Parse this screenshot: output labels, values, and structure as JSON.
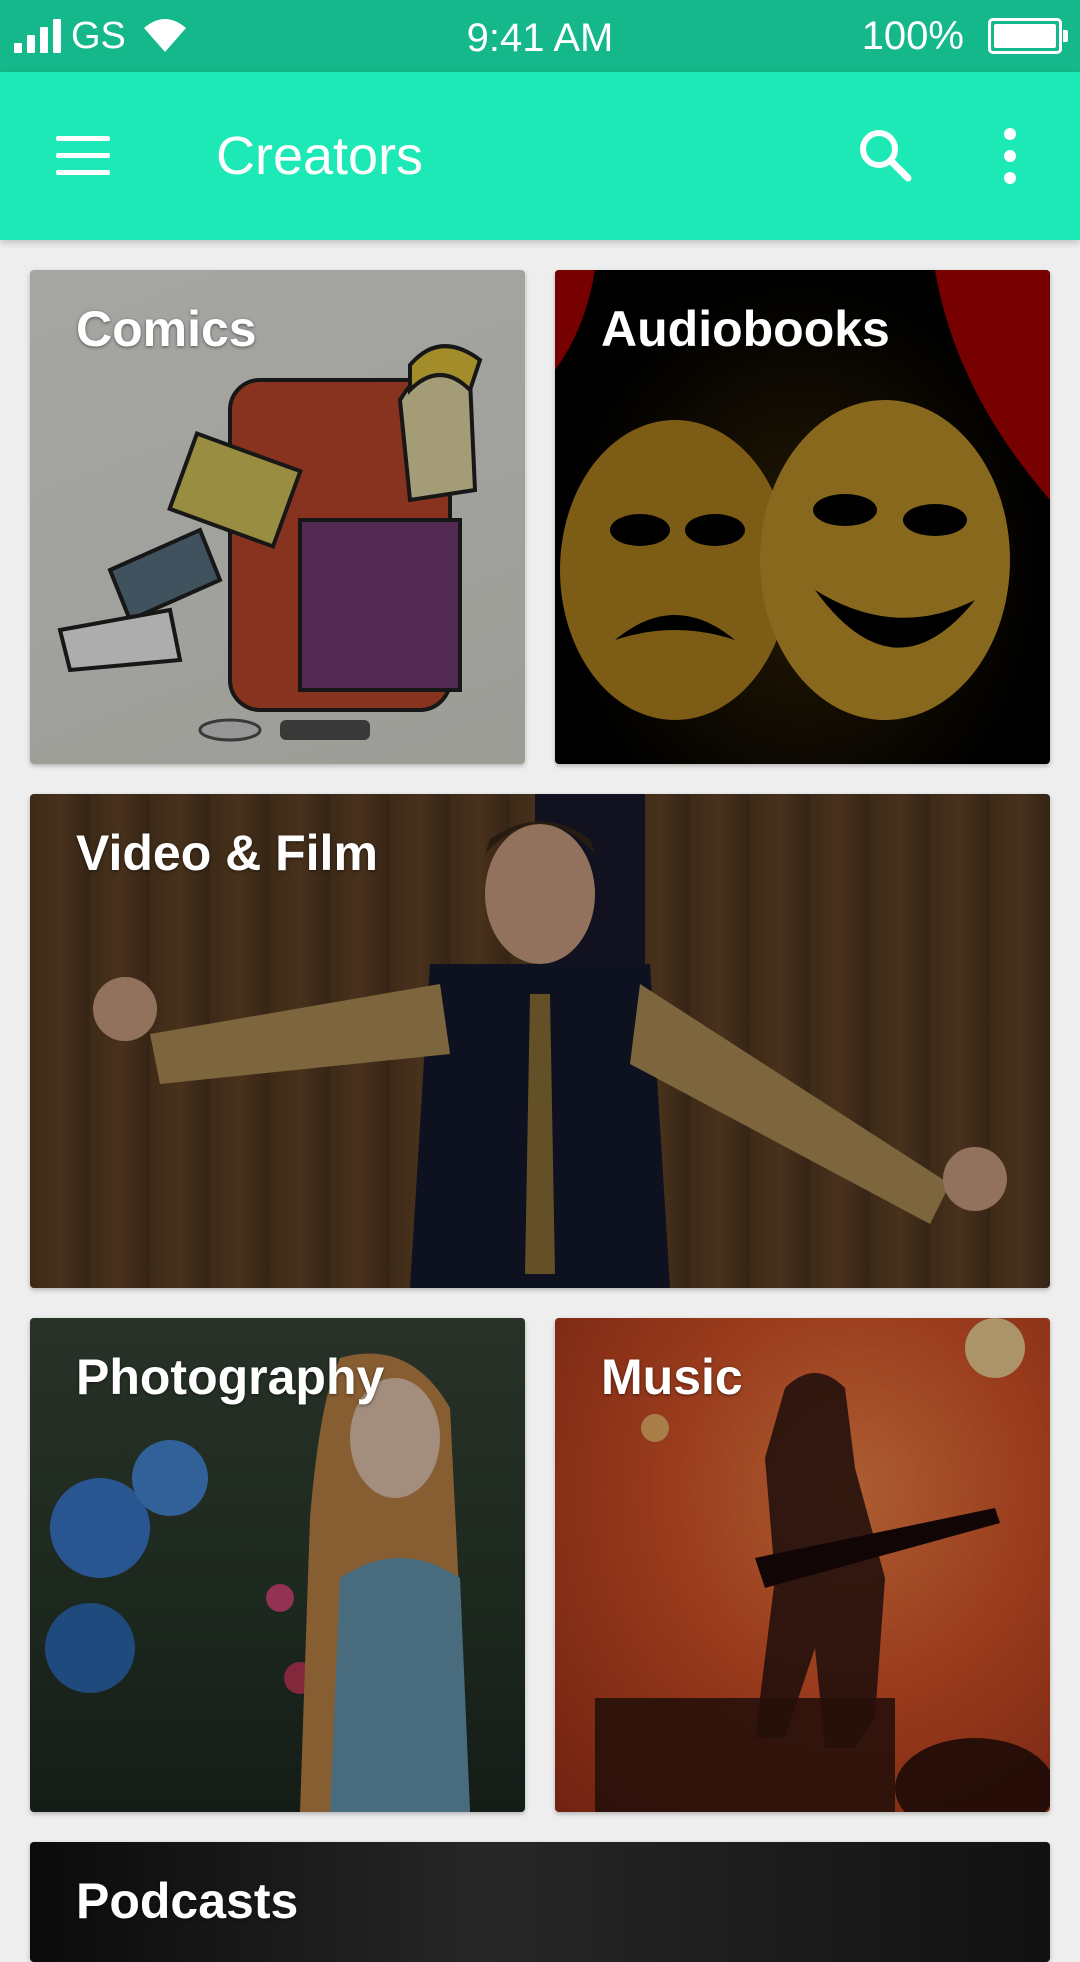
{
  "status_bar": {
    "carrier": "GS",
    "time": "9:41 AM",
    "battery": "100%",
    "icons": [
      "signal-icon",
      "wifi-icon",
      "battery-icon"
    ]
  },
  "app_bar": {
    "title": "Creators",
    "icons": [
      "menu-icon",
      "search-icon",
      "more-vert-icon"
    ],
    "colors": {
      "app_bar": "#1de9b6",
      "status_bar": "#14b88a"
    }
  },
  "categories": [
    {
      "label": "Comics"
    },
    {
      "label": "Audiobooks"
    },
    {
      "label": "Video & Film"
    },
    {
      "label": "Photography"
    },
    {
      "label": "Music"
    },
    {
      "label": "Podcasts"
    }
  ]
}
